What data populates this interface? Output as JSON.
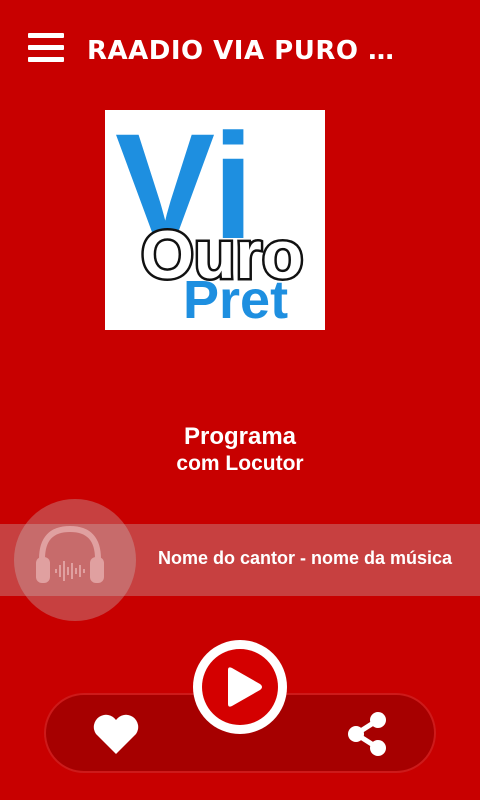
{
  "header": {
    "title": "RAADIO VIA PURO PRETO",
    "menu_icon": "hamburger-menu-icon"
  },
  "logo": {
    "alt": "Via Ouro Preto",
    "line1": "Vi",
    "line2": "Ouro",
    "line3": "Pret"
  },
  "program": {
    "name": "Programa",
    "host": "com Locutor"
  },
  "now_playing": {
    "text": "Nome do cantor - nome da música",
    "icon": "headphones-icon"
  },
  "controls": {
    "favorite_icon": "heart-icon",
    "play_icon": "play-icon",
    "share_icon": "share-icon"
  },
  "colors": {
    "background": "#c80000",
    "controls_bg": "#a60000",
    "play_fill": "#d40000",
    "logo_blue": "#1e8fe0",
    "text": "#ffffff"
  }
}
